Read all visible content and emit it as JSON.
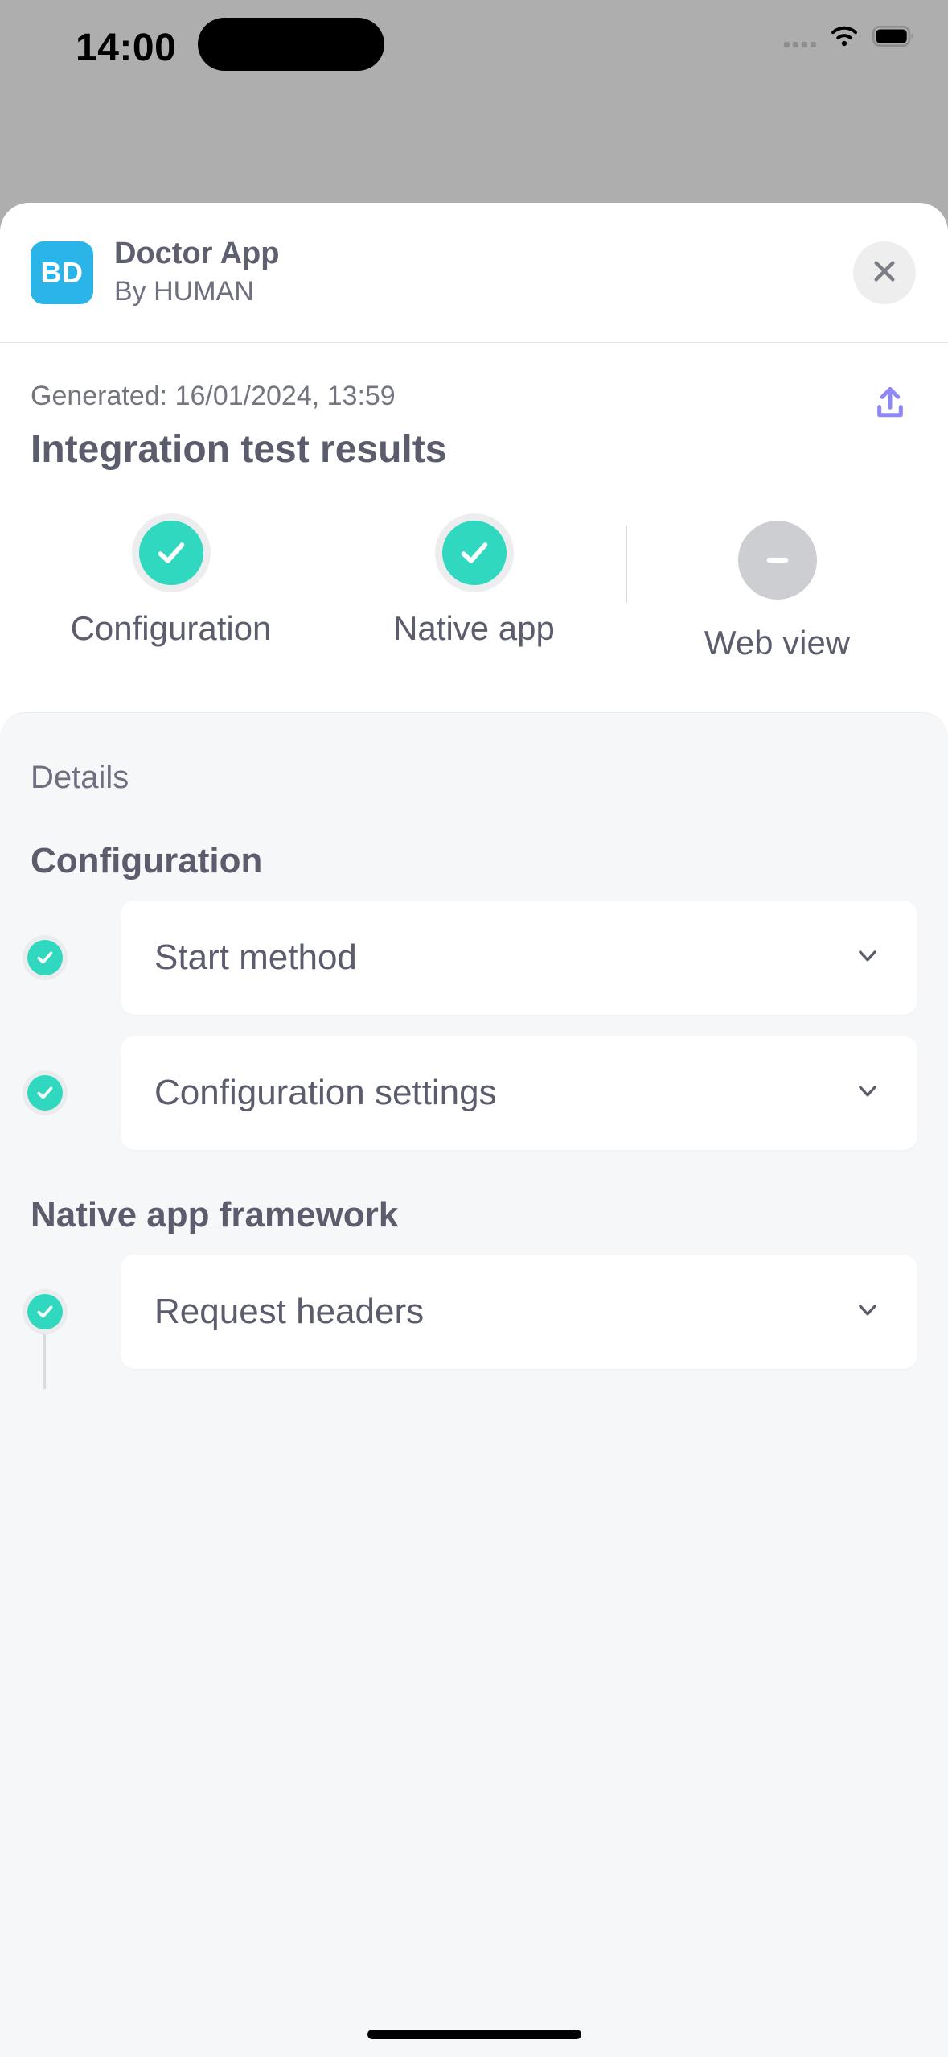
{
  "status_bar": {
    "time": "14:00",
    "cellular_icon": "cellular-dots-icon",
    "wifi_icon": "wifi-icon",
    "battery_icon": "battery-icon"
  },
  "sheet": {
    "header": {
      "app_badge_text": "BD",
      "app_badge_color": "#2ab4e8",
      "app_title": "Doctor App",
      "app_author": "By HUMAN",
      "close_icon": "close-icon"
    },
    "report": {
      "generated": "Generated: 16/01/2024, 13:59",
      "title": "Integration test results",
      "share_icon": "upload-icon",
      "share_icon_color": "#8d88f5"
    },
    "summary": {
      "pass_color": "#2fd8be",
      "skip_color": "#cdced1",
      "items": [
        {
          "label": "Configuration",
          "status": "pass",
          "icon": "check-icon"
        },
        {
          "label": "Native app",
          "status": "pass",
          "icon": "check-icon"
        },
        {
          "label": "Web view",
          "status": "skipped",
          "icon": "minus-icon"
        }
      ]
    },
    "details": {
      "label": "Details",
      "sections": [
        {
          "title": "Configuration",
          "rows": [
            {
              "label": "Start method",
              "status": "pass",
              "icon": "check-icon",
              "chevron": "chevron-down-icon"
            },
            {
              "label": "Configuration settings",
              "status": "pass",
              "icon": "check-icon",
              "chevron": "chevron-down-icon"
            }
          ]
        },
        {
          "title": "Native app framework",
          "rows": [
            {
              "label": "Request headers",
              "status": "pass",
              "icon": "check-icon",
              "chevron": "chevron-down-icon"
            }
          ]
        }
      ]
    }
  }
}
